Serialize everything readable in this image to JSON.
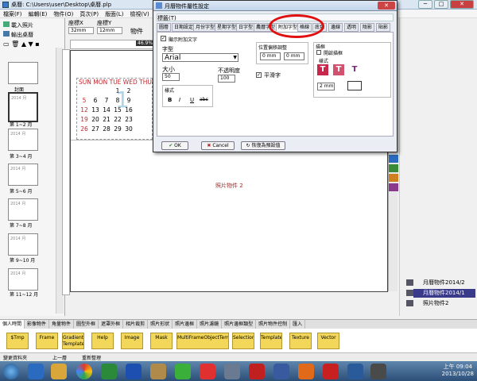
{
  "window": {
    "title": "桌曆: C:\\Users\\user\\Desktop\\桌曆.plp",
    "minimize": "─",
    "maximize": "□",
    "close": "✕"
  },
  "menu": [
    "檔案(F)",
    "編輯(E)",
    "物件(O)",
    "頁次(P)",
    "版面(L)",
    "檢視(V)"
  ],
  "left": {
    "load_photos": "載入照片",
    "export_desktop": "輸出桌曆",
    "pages": [
      "封面",
      "第 1~2 月",
      "第 3~4 月",
      "第 5~6 月",
      "第 7~8 月",
      "第 9~10 月",
      "第 11~12 月"
    ],
    "thumb_year": "2014 月"
  },
  "coords": {
    "x_label": "座標X",
    "y_label": "座標Y",
    "x_value": "32mm",
    "y_value": "12mm",
    "obj_prop_label": "物件",
    "zoom": "46.9%"
  },
  "calendar": {
    "header": "SUN MON TUE WED THUFR",
    "rows": [
      [
        "",
        "",
        "",
        "1",
        "2",
        ""
      ],
      [
        "5",
        "6",
        "7",
        "8",
        "9",
        ""
      ],
      [
        "12",
        "13",
        "14",
        "15",
        "16",
        ""
      ],
      [
        "19",
        "20",
        "21",
        "22",
        "23",
        ""
      ],
      [
        "26",
        "27",
        "28",
        "29",
        "30",
        ""
      ]
    ],
    "overlay_digit": "1",
    "photo_label": "照片物件 2"
  },
  "dialog": {
    "title": "月曆物件屬性設定",
    "subtitle": "標籤(T)",
    "tabs": [
      "圖層",
      "日期設定",
      "月份字型",
      "星期字型",
      "日字型",
      "農曆字型",
      "附加字型",
      "格線",
      "底色",
      "邊線",
      "透明",
      "陰影",
      "貼影"
    ],
    "active_tab": "附加字型",
    "show_extra": "顯示附加文字",
    "font_label": "字型",
    "font_value": "Arial",
    "size_label": "大小",
    "size_value": "50",
    "opacity_label": "不透明度",
    "opacity_value": "100",
    "style_label": "樣式",
    "pos_label": "位置偏移調整",
    "pos_x": "0",
    "pos_y": "0",
    "pos_unit": "mm",
    "smooth_label": "平滑字",
    "outline_label": "描框",
    "outline_enable": "開啟描框",
    "outline_style": "樣式",
    "outline_width": "2",
    "outline_width_unit": "mm",
    "ok": "OK",
    "cancel": "Cancel",
    "restore": "恢復為預設值"
  },
  "layers": [
    "月曆物件2014/2",
    "月曆物件2014/1",
    "照片物件2"
  ],
  "bottom_tabs": [
    "個人時間",
    "影像物件",
    "角量物件",
    "圖型外框",
    "遮罩外框",
    "相片裁剪",
    "照片形狀",
    "照片邊框",
    "照片濾鏡",
    "照片邊框類型",
    "照片物件控制",
    "匯入"
  ],
  "folders": [
    "$Tmp",
    "Frame",
    "Gradient Template",
    "Help",
    "Image",
    "Mask",
    "MultiFrameObjectTemplat",
    "Selection",
    "Template",
    "Texture",
    "Vector"
  ],
  "status": {
    "left": "變更資料夾",
    "up": "上一層",
    "refresh": "重新整理"
  },
  "taskbar": {
    "time": "上午 09:04",
    "date": "2013/10/28"
  },
  "colors": {
    "accent": "#3a3a8a",
    "highlight": "#e01010",
    "sunday": "#c0282d",
    "photo_text": "#9b2c2c"
  }
}
